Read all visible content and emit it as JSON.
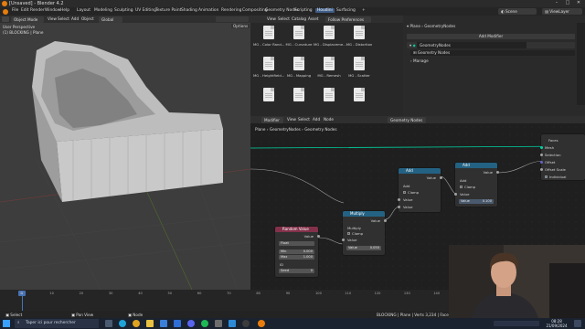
{
  "window": {
    "title": "[Unsaved] - Blender 4.2"
  },
  "menubar": {
    "items": [
      "File",
      "Edit",
      "Render",
      "Window",
      "Help"
    ],
    "workspaces": [
      "Layout",
      "Modeling",
      "Sculpting",
      "UV Editing",
      "Texture Paint",
      "Shading",
      "Animation",
      "Rendering",
      "Compositing",
      "Geometry Nodes",
      "Scripting",
      "Houdini",
      "Surfacing"
    ],
    "active_workspace": "Houdini",
    "scene": "Scene",
    "view_layer": "ViewLayer"
  },
  "viewport": {
    "mode": "Object Mode",
    "menu": [
      "View",
      "Select",
      "Add",
      "Object"
    ],
    "transform": "Global",
    "options": "Options",
    "info_line1": "User Perspective",
    "info_line2": "(1) BLOCKING | Plane"
  },
  "filebrowser": {
    "menu": [
      "View",
      "Select",
      "Catalog",
      "Asset"
    ],
    "library": "Follow Preferences",
    "files": [
      {
        "name": "MG - Color Rand..."
      },
      {
        "name": "MG - Curvature"
      },
      {
        "name": "MG - Displaceme..."
      },
      {
        "name": "MG - Distortion"
      },
      {
        "name": "MG - Heightfield..."
      },
      {
        "name": "MG - Mapping"
      },
      {
        "name": "MG - Remesh"
      },
      {
        "name": "MG - Scatter"
      },
      {
        "name": ""
      },
      {
        "name": ""
      },
      {
        "name": ""
      },
      {
        "name": ""
      }
    ]
  },
  "properties": {
    "breadcrumb": [
      "Plane",
      "GeometryNodes"
    ],
    "add_modifier": "Add Modifier",
    "modifier_name": "GeometryNodes",
    "node_group": "Geometry Nodes",
    "manage": "Manage"
  },
  "nodeeditor": {
    "editor_type": "Modifier",
    "menu": [
      "View",
      "Select",
      "Add",
      "Node"
    ],
    "tree_name": "Geometry Nodes",
    "breadcrumb": [
      "Plane",
      "GeometryNodes",
      "Geometry Nodes"
    ],
    "nodes": {
      "random": {
        "title": "Random Value",
        "out_value": "Value",
        "type": "Float",
        "min_label": "Min",
        "min_value": "0.000",
        "max_label": "Max",
        "max_value": "1.000",
        "id_label": "ID",
        "seed_label": "Seed",
        "seed_value": "0"
      },
      "multiply": {
        "title": "Multiply",
        "out_value": "Value",
        "operation": "Multiply",
        "clamp": "Clamp",
        "in_value": "Value",
        "field_label": "Value",
        "field_value": "0.050"
      },
      "add1": {
        "title": "Add",
        "out_value": "Value",
        "operation": "Add",
        "clamp": "Clamp",
        "in_value1": "Value",
        "in_value2": "Value"
      },
      "add2": {
        "title": "Add",
        "out_value": "Value",
        "operation": "Add",
        "clamp": "Clamp",
        "in_value": "Value",
        "field_label": "Value",
        "field_value": "0.100"
      },
      "set_position": {
        "title": "Faces",
        "rows": [
          "Mesh",
          "Selection",
          "Offset",
          "Offset Scale",
          "Individual"
        ]
      }
    }
  },
  "timeline": {
    "frame_ticks": [
      "0",
      "10",
      "20",
      "30",
      "40",
      "50",
      "60",
      "70",
      "80",
      "90",
      "100",
      "110",
      "120",
      "130",
      "140",
      "150",
      "160",
      "170",
      "180"
    ],
    "current_frame": "1"
  },
  "statusbar": {
    "items": [
      "Select",
      "Pan View",
      "Node"
    ],
    "right": "BLOCKING | Plane | Verts 3,234 | Faces 2,3"
  },
  "taskbar": {
    "search_placeholder": "Taper ici pour rechercher",
    "time": "08:28",
    "date": "21/09/2024"
  }
}
